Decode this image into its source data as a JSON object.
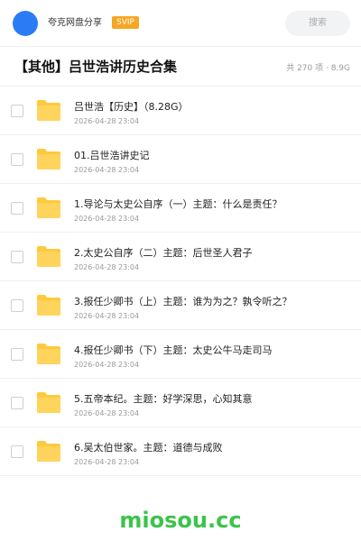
{
  "header": {
    "username": "夸克网盘分享",
    "badge": "SVIP",
    "search_placeholder": "搜索"
  },
  "folder": {
    "title": "【其他】吕世浩讲历史合集",
    "meta": "共 270 项 · 8.9G"
  },
  "items": [
    {
      "name": "吕世浩【历史】（8.28G）",
      "date": "2026-04-28 23:04"
    },
    {
      "name": "01.吕世浩讲史记",
      "date": "2026-04-28 23:04"
    },
    {
      "name": "1.导论与太史公自序（一）主题：什么是责任？",
      "date": "2026-04-28 23:04"
    },
    {
      "name": "2.太史公自序（二）主题：后世圣人君子",
      "date": "2026-04-28 23:04"
    },
    {
      "name": "3.报任少卿书（上）主题：谁为为之？孰令听之？",
      "date": "2026-04-28 23:04"
    },
    {
      "name": "4.报任少卿书（下）主题：太史公牛马走司马",
      "date": "2026-04-28 23:04"
    },
    {
      "name": "5.五帝本纪。主题：好学深思，心知其意",
      "date": "2026-04-28 23:04"
    },
    {
      "name": "6.吴太伯世家。主题：道德与成败",
      "date": "2026-04-28 23:04"
    }
  ],
  "watermark": "miosou.cc",
  "colors": {
    "accent": "#2b7cf4",
    "badge": "#f5a623",
    "folder": "#ffc93c",
    "watermark": "#3cc34b"
  },
  "icons": {
    "folder": "folder-icon",
    "checkbox": "checkbox-icon"
  }
}
